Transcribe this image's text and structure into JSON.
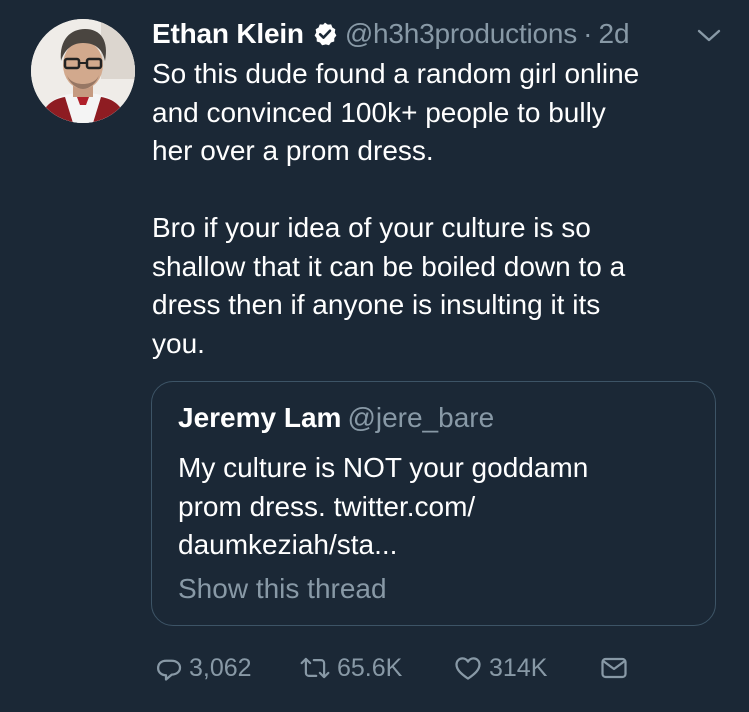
{
  "tweet": {
    "author_name": "Ethan Klein",
    "handle": "@h3h3productions",
    "separator": "·",
    "timestamp": "2d",
    "text": "So this dude found a random girl online\nand convinced 100k+ people to bully\nher over a prom dress.\n\nBro if your idea of your culture is so\nshallow that it can be boiled down to a\ndress then if anyone is insulting it its\nyou."
  },
  "quoted_tweet": {
    "author_name": "Jeremy Lam",
    "handle": "@jere_bare",
    "text": "My culture is NOT your goddamn\nprom dress. twitter.com/\ndaumkeziah/sta...",
    "thread_link": "Show this thread"
  },
  "actions": {
    "replies": "3,062",
    "retweets": "65.6K",
    "likes": "314K"
  },
  "colors": {
    "background": "#1b2836",
    "primary_text": "#ffffff",
    "secondary_text": "#8899a6",
    "border": "#3d5466",
    "verified_badge": "#ffffff"
  },
  "icons": [
    "verified-badge-icon",
    "chevron-down-icon",
    "reply-icon",
    "retweet-icon",
    "like-icon",
    "direct-message-icon"
  ]
}
